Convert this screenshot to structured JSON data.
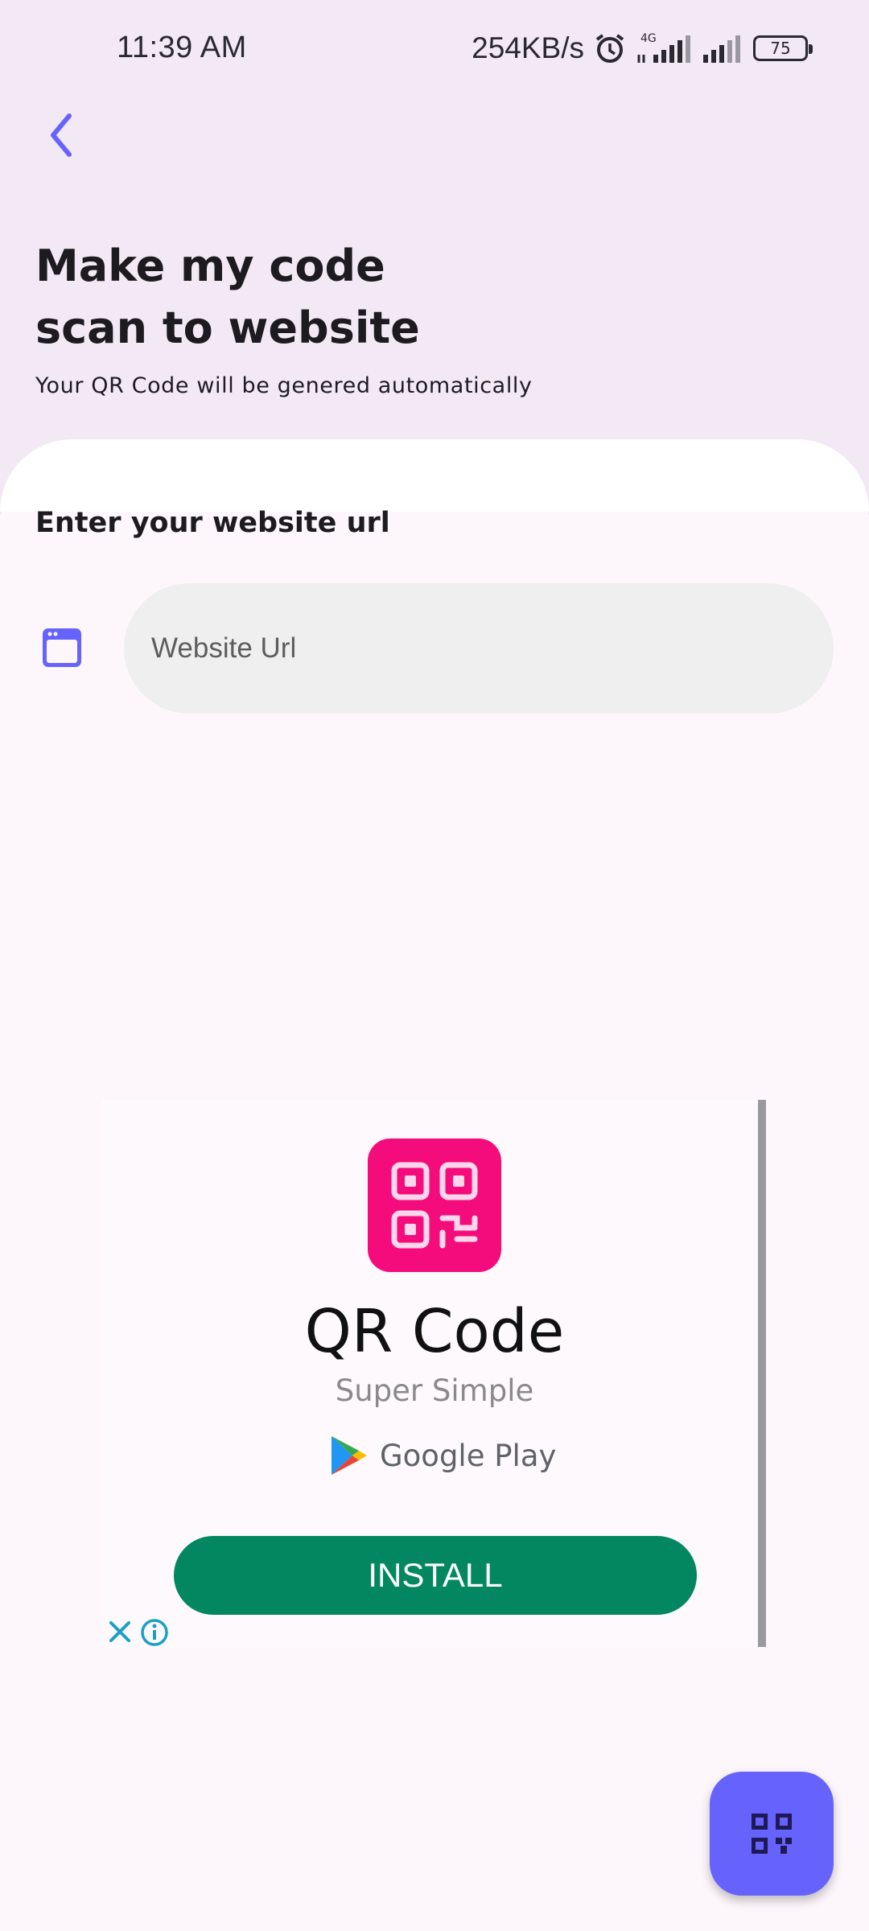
{
  "status_bar": {
    "time": "11:39 AM",
    "speed": "254KB/s",
    "network": "4G",
    "battery": "75"
  },
  "header": {
    "title": "Make my code scan to website",
    "subtitle": "Your QR Code will be genered automatically"
  },
  "form": {
    "label": "Enter your website url",
    "url_placeholder": "Website Url",
    "url_value": ""
  },
  "ad": {
    "title": "QR Code",
    "subtitle": "Super Simple",
    "store": "Google Play",
    "install_label": "INSTALL"
  },
  "colors": {
    "accent": "#6563fc",
    "header_bg": "#f3e9f5",
    "install_green": "#028760",
    "ad_logo": "#f40c7d"
  }
}
